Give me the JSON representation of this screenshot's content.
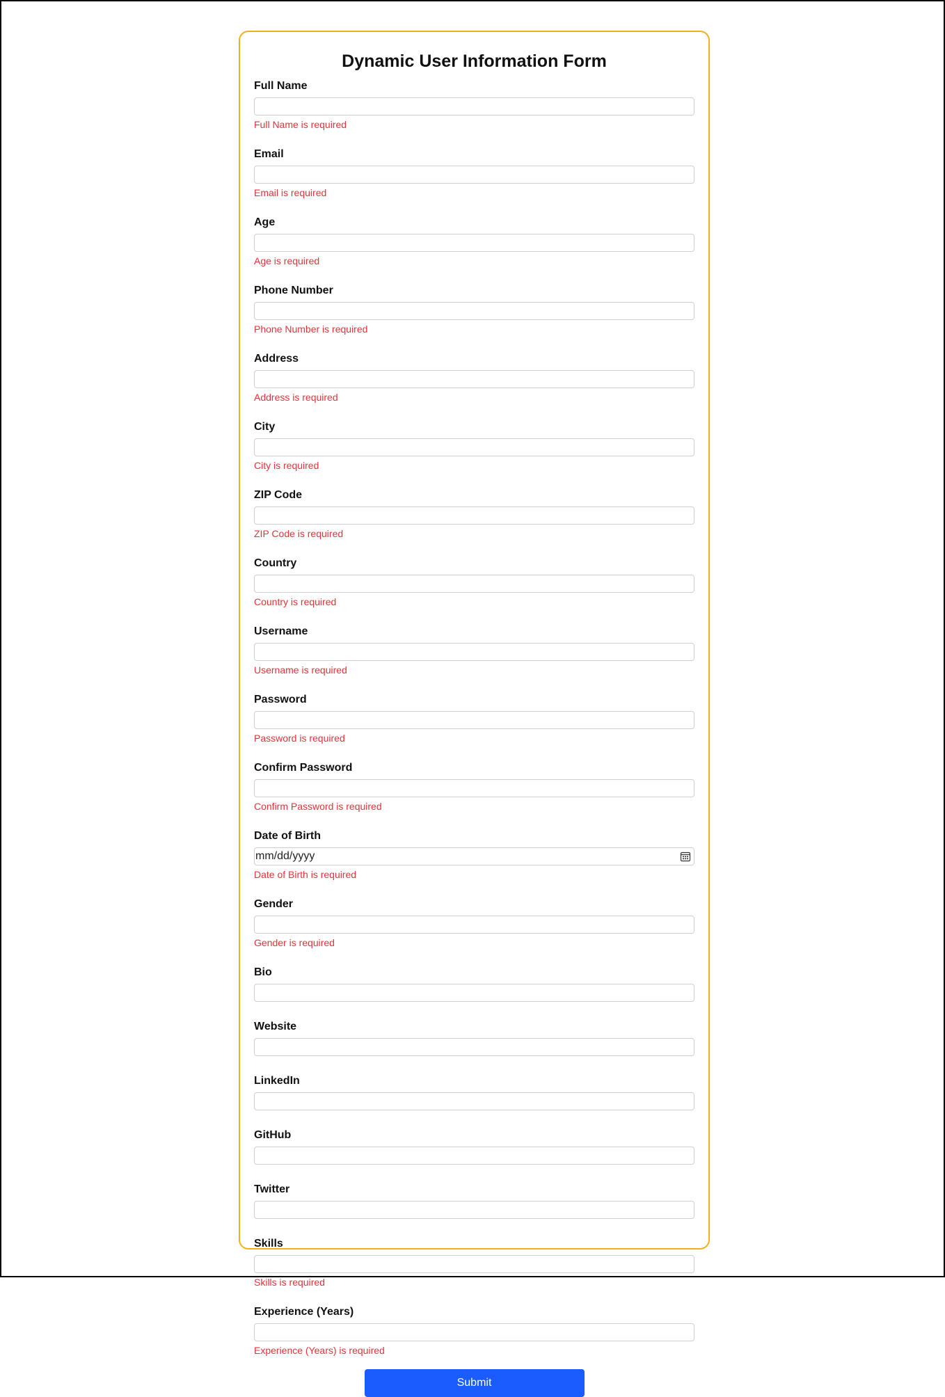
{
  "form": {
    "title": "Dynamic User Information Form",
    "submit_label": "Submit",
    "fields": [
      {
        "label": "Full Name",
        "error": "Full Name is required"
      },
      {
        "label": "Email",
        "error": "Email is required"
      },
      {
        "label": "Age",
        "error": "Age is required"
      },
      {
        "label": "Phone Number",
        "error": "Phone Number is required"
      },
      {
        "label": "Address",
        "error": "Address is required"
      },
      {
        "label": "City",
        "error": "City is required"
      },
      {
        "label": "ZIP Code",
        "error": "ZIP Code is required"
      },
      {
        "label": "Country",
        "error": "Country is required"
      },
      {
        "label": "Username",
        "error": "Username is required"
      },
      {
        "label": "Password",
        "error": "Password is required"
      },
      {
        "label": "Confirm Password",
        "error": "Confirm Password is required"
      },
      {
        "label": "Date of Birth",
        "error": "Date of Birth is required",
        "value": "mm/dd/yyyy"
      },
      {
        "label": "Gender",
        "error": "Gender is required"
      },
      {
        "label": "Bio"
      },
      {
        "label": "Website"
      },
      {
        "label": "LinkedIn"
      },
      {
        "label": "GitHub"
      },
      {
        "label": "Twitter"
      },
      {
        "label": "Skills",
        "error": "Skills is required"
      },
      {
        "label": "Experience (Years)",
        "error": "Experience (Years) is required"
      }
    ]
  },
  "colors": {
    "card_border": "#f2b01e",
    "error_text": "#e8303a",
    "submit_bg": "#1a5cff"
  }
}
